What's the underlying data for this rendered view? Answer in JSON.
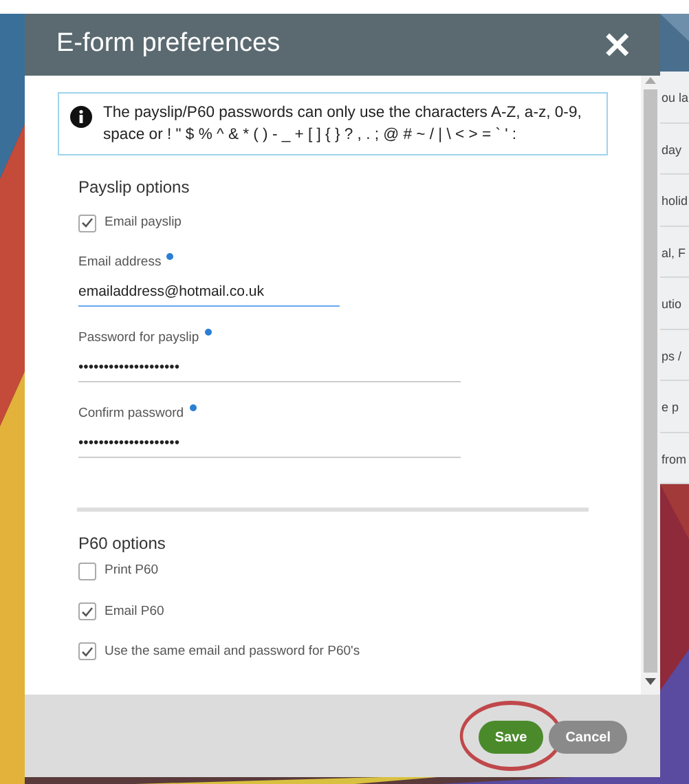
{
  "background_texts": [
    "ou la",
    "day",
    "holid",
    "al, F",
    "utio",
    "ps /",
    "e p",
    "from"
  ],
  "dialog": {
    "title": "E-form preferences",
    "close_icon": "✕",
    "info": "The payslip/P60 passwords can only use the characters A-Z, a-z, 0-9, space or ! \" $ % ^ & * ( ) - _ + [ ] { } ? , . ; @ # ~ / | \\ < > = ` ' :",
    "sections": [
      {
        "heading": "Payslip options",
        "items": [
          {
            "kind": "checkbox",
            "label": "Email payslip",
            "checked": true
          },
          {
            "kind": "field",
            "label": "Email address",
            "required": true,
            "value": "emailaddress@hotmail.co.uk",
            "focused": true
          },
          {
            "kind": "field",
            "label": "Password for payslip",
            "required": true,
            "value": "••••••••••••••••••••",
            "focused": false
          },
          {
            "kind": "field",
            "label": "Confirm password",
            "required": true,
            "value": "••••••••••••••••••••",
            "focused": false
          }
        ]
      },
      {
        "heading": "P60 options",
        "items": [
          {
            "kind": "checkbox",
            "label": "Print P60",
            "checked": false
          },
          {
            "kind": "checkbox",
            "label": "Email P60",
            "checked": true
          },
          {
            "kind": "checkbox",
            "label": "Use the same email and password for P60's",
            "checked": true
          }
        ]
      }
    ],
    "buttons": [
      {
        "label": "Save",
        "kind": "primary",
        "circled": true
      },
      {
        "label": "Cancel",
        "kind": "secondary",
        "circled": false
      }
    ]
  }
}
